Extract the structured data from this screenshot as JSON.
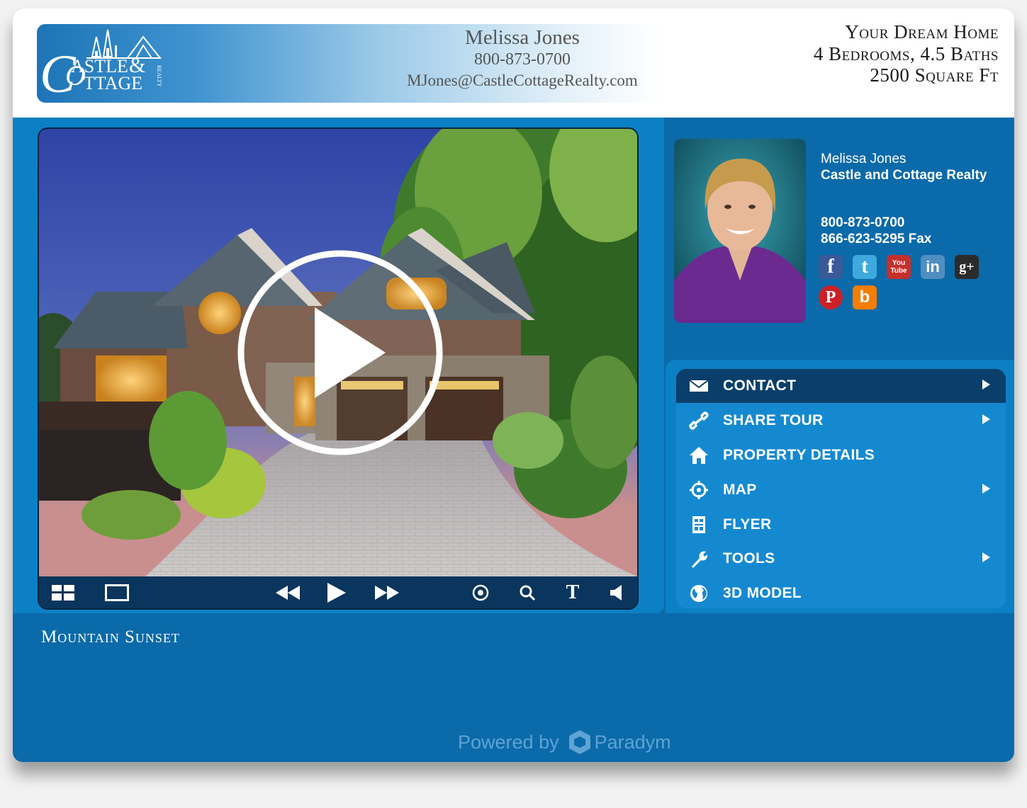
{
  "header": {
    "brand_logo_text": "Castle & Cottage Realty",
    "agent_name": "Melissa Jones",
    "agent_phone": "800-873-0700",
    "agent_email": "MJones@CastleCottageRealty.com",
    "property_title": "Your Dream Home",
    "property_rooms": "4 Bedrooms, 4.5 Baths",
    "property_size": "2500 Square Ft"
  },
  "viewer": {
    "controls": [
      "thumbnails-icon",
      "fullscreen-icon",
      "rewind-icon",
      "play-icon",
      "fast-forward-icon",
      "target-icon",
      "search-icon",
      "text-icon",
      "volume-icon"
    ],
    "text_button_label": "T",
    "caption": "Mountain Sunset"
  },
  "agent_card": {
    "name": "Melissa Jones",
    "company": "Castle and Cottage Realty",
    "phone": "800-873-0700",
    "fax": "866-623-5295  Fax"
  },
  "social": [
    {
      "name": "facebook",
      "label": "f",
      "color": "#3b5998"
    },
    {
      "name": "twitter",
      "label": "t",
      "color": "#3fa9dd"
    },
    {
      "name": "youtube",
      "label": "You Tube",
      "color": "#c4302b"
    },
    {
      "name": "linkedin",
      "label": "in",
      "color": "#4f8fc0"
    },
    {
      "name": "googleplus",
      "label": "g+",
      "color": "#2b2b2b"
    },
    {
      "name": "pinterest",
      "label": "P",
      "color": "#cb2027"
    },
    {
      "name": "blogger",
      "label": "b",
      "color": "#f57d00"
    }
  ],
  "menu": [
    {
      "label": "CONTACT",
      "icon": "envelope-icon",
      "submenu": true,
      "active": true
    },
    {
      "label": "SHARE TOUR",
      "icon": "link-icon",
      "submenu": true,
      "active": false
    },
    {
      "label": "PROPERTY DETAILS",
      "icon": "home-icon",
      "submenu": false,
      "active": false
    },
    {
      "label": "MAP",
      "icon": "crosshair-icon",
      "submenu": true,
      "active": false
    },
    {
      "label": "FLYER",
      "icon": "flyer-icon",
      "submenu": false,
      "active": false
    },
    {
      "label": "TOOLS",
      "icon": "wrench-icon",
      "submenu": true,
      "active": false
    },
    {
      "label": "3D MODEL",
      "icon": "globe-icon",
      "submenu": false,
      "active": false
    }
  ],
  "footer": {
    "powered_by": "Powered by",
    "brand": "Paradym"
  },
  "colors": {
    "page_blue": "#0b6aa9",
    "panel_blue": "#0c80c4",
    "menu_blue": "#1589d0",
    "menu_active": "#0a3f6b",
    "control_bar": "#0a355c"
  }
}
